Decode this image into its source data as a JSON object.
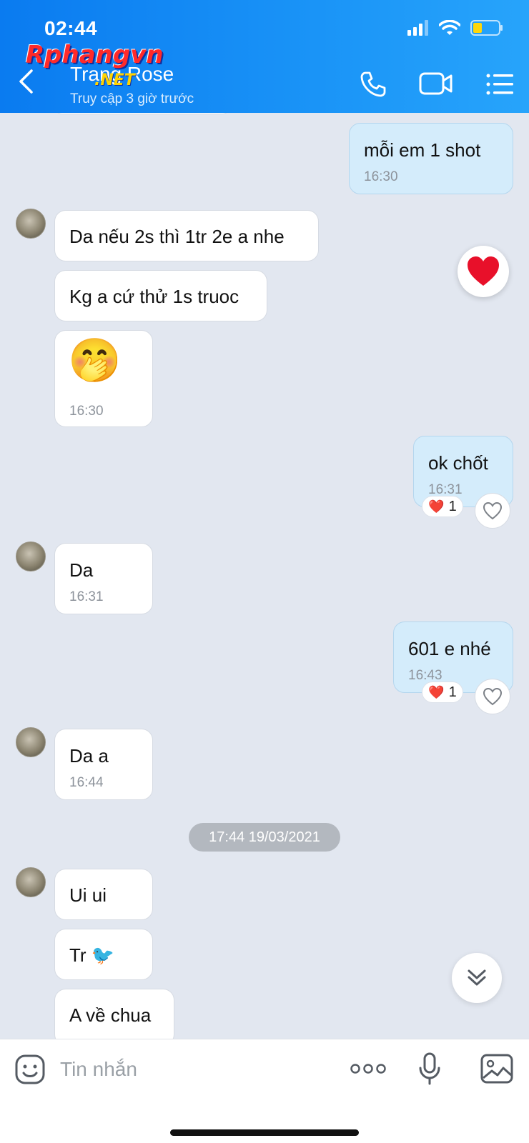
{
  "status_bar": {
    "time": "02:44"
  },
  "watermark": {
    "main": "Rphangvn",
    "sub": ".NET"
  },
  "header": {
    "contact_name": "Trang Rose",
    "contact_status": "Truy cập 3 giờ trước",
    "icons": [
      "back-arrow-icon",
      "phone-icon",
      "video-call-icon",
      "menu-list-icon"
    ]
  },
  "messages": [
    {
      "dir": "out",
      "text": "mỗi em 1 shot",
      "time": "16:30"
    },
    {
      "dir": "in",
      "text": "Da nếu 2s thì 1tr 2e a nhe"
    },
    {
      "dir": "in",
      "text": "Kg a cứ thử 1s truoc"
    },
    {
      "dir": "in",
      "text": "🤭",
      "time": "16:30"
    },
    {
      "dir": "out",
      "text": "ok chốt",
      "time": "16:31",
      "reaction": "❤️",
      "reaction_count": "1"
    },
    {
      "dir": "in",
      "text": "Da",
      "time": "16:31"
    },
    {
      "dir": "out",
      "text": "601 e nhé",
      "time": "16:43",
      "reaction": "❤️",
      "reaction_count": "1"
    },
    {
      "dir": "in",
      "text": "Da a",
      "time": "16:44"
    },
    {
      "dir": "in",
      "text": "Ui ui"
    },
    {
      "dir": "in",
      "text": "Tr 🐦"
    },
    {
      "dir": "in",
      "text": "A về chua"
    }
  ],
  "date_separator": "17:44 19/03/2021",
  "composer": {
    "placeholder": "Tin nhắn"
  },
  "colors": {
    "header": "#0a7bf0",
    "outgoing_bubble": "#d4ecfb",
    "incoming_bubble": "#ffffff",
    "chat_bg": "#e2e7f0",
    "heart": "#e8102a"
  }
}
